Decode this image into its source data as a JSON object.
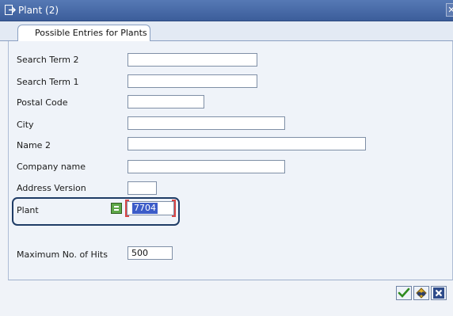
{
  "window": {
    "title": "Plant (2)"
  },
  "tabs": [
    {
      "label": "Possible Entries for Plants"
    }
  ],
  "form": {
    "fields": [
      {
        "label": "Search Term 2",
        "value": ""
      },
      {
        "label": "Search Term 1",
        "value": ""
      },
      {
        "label": "Postal Code",
        "value": ""
      },
      {
        "label": "City",
        "value": ""
      },
      {
        "label": "Name 2",
        "value": ""
      },
      {
        "label": "Company name",
        "value": ""
      },
      {
        "label": "Address Version",
        "value": ""
      },
      {
        "label": "Plant",
        "value": "7704"
      },
      {
        "label": "Maximum No. of Hits",
        "value": "500"
      }
    ]
  },
  "buttons": {
    "ok": "checkmark-icon",
    "find": "binoculars-icon",
    "cancel": "cancel-x-icon",
    "close": "close-icon"
  },
  "colors": {
    "title_bar": "#3c5d9a",
    "highlight_border": "#1f3c66",
    "selected_text_bg": "#3c5cc8",
    "required_marker": "#d94646"
  }
}
